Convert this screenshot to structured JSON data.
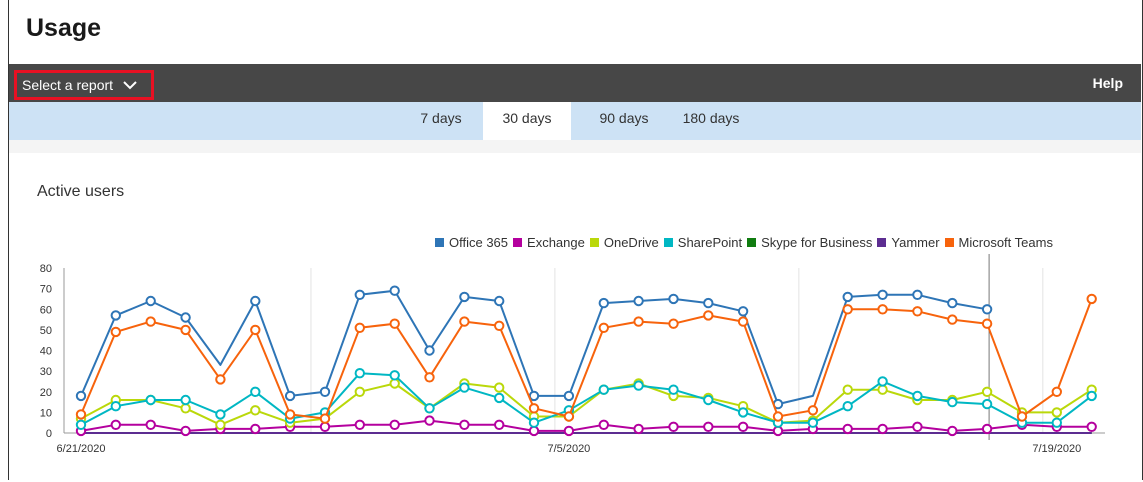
{
  "page": {
    "title": "Usage"
  },
  "toolbar": {
    "report_select_label": "Select a report",
    "help_label": "Help"
  },
  "tabs": [
    {
      "label": "7 days",
      "active": false
    },
    {
      "label": "30 days",
      "active": true
    },
    {
      "label": "90 days",
      "active": false
    },
    {
      "label": "180 days",
      "active": false
    }
  ],
  "icons": {
    "report_select": "chevron-down-icon"
  },
  "colors": {
    "accent_red": "#e81123",
    "topbar": "#474747",
    "tabbar": "#cde2f5"
  },
  "chart_data": {
    "type": "line",
    "title": "Active users",
    "xlabel": "",
    "ylabel": "",
    "ylim": [
      0,
      80
    ],
    "y_ticks": [
      "0",
      "10",
      "20",
      "30",
      "40",
      "50",
      "60",
      "70",
      "80"
    ],
    "x_tick_labels": [
      {
        "index": 0,
        "label": "6/21/2020"
      },
      {
        "index": 14,
        "label": "7/5/2020"
      },
      {
        "index": 28,
        "label": "7/19/2020"
      }
    ],
    "legend_position": "top-right",
    "grid": "vertical-weekly",
    "x": [
      0,
      1,
      2,
      3,
      4,
      5,
      6,
      7,
      8,
      9,
      10,
      11,
      12,
      13,
      14,
      15,
      16,
      17,
      18,
      19,
      20,
      21,
      22,
      23,
      24,
      25,
      26,
      27,
      28,
      29
    ],
    "series": [
      {
        "name": "Office 365",
        "color": "#2e75b6",
        "markers": "partial",
        "values": [
          18,
          57,
          64,
          56,
          33,
          64,
          18,
          20,
          67,
          69,
          40,
          66,
          64,
          18,
          18,
          63,
          64,
          65,
          63,
          59,
          14,
          18,
          66,
          67,
          67,
          63,
          60,
          null,
          null,
          null
        ]
      },
      {
        "name": "Exchange",
        "color": "#b4009e",
        "markers": "all",
        "values": [
          1,
          4,
          4,
          1,
          2,
          2,
          3,
          3,
          4,
          4,
          6,
          4,
          4,
          1,
          1,
          4,
          2,
          3,
          3,
          3,
          1,
          2,
          2,
          2,
          3,
          1,
          2,
          4,
          3,
          3
        ]
      },
      {
        "name": "OneDrive",
        "color": "#bad80a",
        "markers": "all",
        "values": [
          7,
          16,
          16,
          12,
          4,
          11,
          5,
          7,
          20,
          24,
          12,
          24,
          22,
          8,
          8,
          21,
          24,
          18,
          17,
          13,
          5,
          6,
          21,
          21,
          16,
          16,
          20,
          10,
          10,
          21
        ]
      },
      {
        "name": "SharePoint",
        "color": "#00b7c3",
        "markers": "all",
        "values": [
          4,
          13,
          16,
          16,
          9,
          20,
          7,
          10,
          29,
          28,
          12,
          22,
          17,
          5,
          11,
          21,
          23,
          21,
          16,
          10,
          5,
          5,
          13,
          25,
          18,
          15,
          14,
          5,
          5,
          18
        ]
      },
      {
        "name": "Skype for Business",
        "color": "#107c10",
        "markers": "none",
        "values": [
          0,
          0,
          0,
          0,
          0,
          0,
          0,
          0,
          0,
          0,
          0,
          0,
          0,
          0,
          0,
          0,
          0,
          0,
          0,
          0,
          0,
          0,
          0,
          0,
          0,
          0,
          0,
          0,
          0,
          0
        ]
      },
      {
        "name": "Yammer",
        "color": "#5c2d91",
        "markers": "none",
        "values": [
          0,
          0,
          0,
          0,
          0,
          0,
          0,
          0,
          0,
          0,
          0,
          0,
          0,
          0,
          0,
          0,
          0,
          0,
          0,
          0,
          0,
          0,
          0,
          0,
          0,
          0,
          0,
          0,
          0,
          0
        ]
      },
      {
        "name": "Microsoft Teams",
        "color": "#f7630c",
        "markers": "all",
        "values": [
          9,
          49,
          54,
          50,
          26,
          50,
          9,
          7,
          51,
          53,
          27,
          54,
          52,
          12,
          8,
          51,
          54,
          53,
          57,
          54,
          8,
          11,
          60,
          60,
          59,
          55,
          53,
          8,
          20,
          65
        ]
      }
    ]
  }
}
